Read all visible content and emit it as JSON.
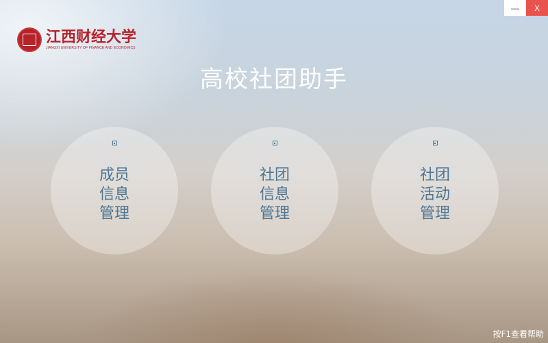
{
  "window": {
    "minimize_label": "—",
    "close_label": "X"
  },
  "logo": {
    "name_cn": "江西财经大学",
    "name_en": "JIANGXI UNIVERSITY OF FINANCE AND ECONOMICS"
  },
  "app_title": "高校社团助手",
  "menu": {
    "items": [
      {
        "lines": [
          "成员",
          "信息",
          "管理"
        ],
        "icon": "square-icon"
      },
      {
        "lines": [
          "社团",
          "信息",
          "管理"
        ],
        "icon": "square-icon"
      },
      {
        "lines": [
          "社团",
          "活动",
          "管理"
        ],
        "icon": "square-icon"
      }
    ]
  },
  "footer": {
    "help_hint": "按F1查看帮助"
  },
  "colors": {
    "accent_text": "#4d7794",
    "close_button": "#e8534c",
    "brand_red": "#b5222a"
  }
}
